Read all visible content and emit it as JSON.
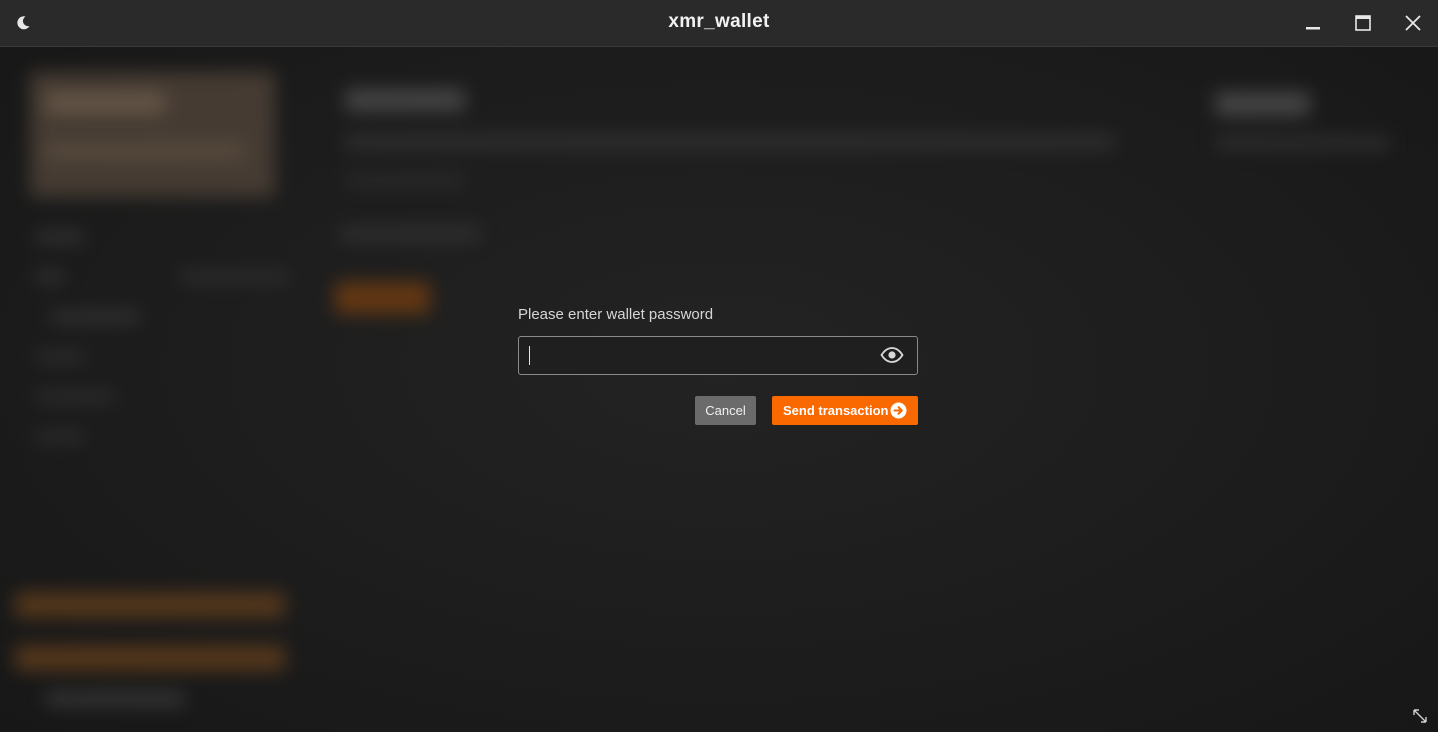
{
  "window": {
    "title": "xmr_wallet"
  },
  "dialog": {
    "prompt": "Please enter wallet password",
    "password_value": "",
    "cancel_label": "Cancel",
    "send_label": "Send transaction"
  },
  "colors": {
    "accent": "#fa6800",
    "cancel_button": "#6b6b6b",
    "titlebar": "#2a2a2a",
    "background": "#1b1b1b"
  },
  "icons": {
    "theme_toggle": "moon-icon",
    "minimize": "minimize-icon",
    "maximize": "maximize-icon",
    "close": "close-icon",
    "password_visibility": "eye-icon",
    "send_arrow": "arrow-right-circle-icon",
    "resize": "resize-grip-icon"
  }
}
